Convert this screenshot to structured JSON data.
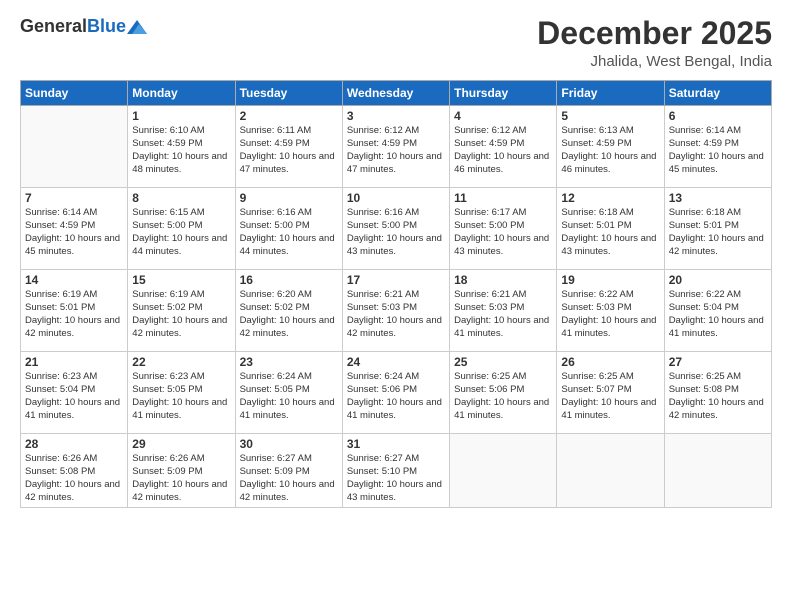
{
  "logo": {
    "general": "General",
    "blue": "Blue"
  },
  "header": {
    "month": "December 2025",
    "location": "Jhalida, West Bengal, India"
  },
  "weekdays": [
    "Sunday",
    "Monday",
    "Tuesday",
    "Wednesday",
    "Thursday",
    "Friday",
    "Saturday"
  ],
  "weeks": [
    [
      {
        "day": "",
        "sunrise": "",
        "sunset": "",
        "daylight": ""
      },
      {
        "day": "1",
        "sunrise": "Sunrise: 6:10 AM",
        "sunset": "Sunset: 4:59 PM",
        "daylight": "Daylight: 10 hours and 48 minutes."
      },
      {
        "day": "2",
        "sunrise": "Sunrise: 6:11 AM",
        "sunset": "Sunset: 4:59 PM",
        "daylight": "Daylight: 10 hours and 47 minutes."
      },
      {
        "day": "3",
        "sunrise": "Sunrise: 6:12 AM",
        "sunset": "Sunset: 4:59 PM",
        "daylight": "Daylight: 10 hours and 47 minutes."
      },
      {
        "day": "4",
        "sunrise": "Sunrise: 6:12 AM",
        "sunset": "Sunset: 4:59 PM",
        "daylight": "Daylight: 10 hours and 46 minutes."
      },
      {
        "day": "5",
        "sunrise": "Sunrise: 6:13 AM",
        "sunset": "Sunset: 4:59 PM",
        "daylight": "Daylight: 10 hours and 46 minutes."
      },
      {
        "day": "6",
        "sunrise": "Sunrise: 6:14 AM",
        "sunset": "Sunset: 4:59 PM",
        "daylight": "Daylight: 10 hours and 45 minutes."
      }
    ],
    [
      {
        "day": "7",
        "sunrise": "Sunrise: 6:14 AM",
        "sunset": "Sunset: 4:59 PM",
        "daylight": "Daylight: 10 hours and 45 minutes."
      },
      {
        "day": "8",
        "sunrise": "Sunrise: 6:15 AM",
        "sunset": "Sunset: 5:00 PM",
        "daylight": "Daylight: 10 hours and 44 minutes."
      },
      {
        "day": "9",
        "sunrise": "Sunrise: 6:16 AM",
        "sunset": "Sunset: 5:00 PM",
        "daylight": "Daylight: 10 hours and 44 minutes."
      },
      {
        "day": "10",
        "sunrise": "Sunrise: 6:16 AM",
        "sunset": "Sunset: 5:00 PM",
        "daylight": "Daylight: 10 hours and 43 minutes."
      },
      {
        "day": "11",
        "sunrise": "Sunrise: 6:17 AM",
        "sunset": "Sunset: 5:00 PM",
        "daylight": "Daylight: 10 hours and 43 minutes."
      },
      {
        "day": "12",
        "sunrise": "Sunrise: 6:18 AM",
        "sunset": "Sunset: 5:01 PM",
        "daylight": "Daylight: 10 hours and 43 minutes."
      },
      {
        "day": "13",
        "sunrise": "Sunrise: 6:18 AM",
        "sunset": "Sunset: 5:01 PM",
        "daylight": "Daylight: 10 hours and 42 minutes."
      }
    ],
    [
      {
        "day": "14",
        "sunrise": "Sunrise: 6:19 AM",
        "sunset": "Sunset: 5:01 PM",
        "daylight": "Daylight: 10 hours and 42 minutes."
      },
      {
        "day": "15",
        "sunrise": "Sunrise: 6:19 AM",
        "sunset": "Sunset: 5:02 PM",
        "daylight": "Daylight: 10 hours and 42 minutes."
      },
      {
        "day": "16",
        "sunrise": "Sunrise: 6:20 AM",
        "sunset": "Sunset: 5:02 PM",
        "daylight": "Daylight: 10 hours and 42 minutes."
      },
      {
        "day": "17",
        "sunrise": "Sunrise: 6:21 AM",
        "sunset": "Sunset: 5:03 PM",
        "daylight": "Daylight: 10 hours and 42 minutes."
      },
      {
        "day": "18",
        "sunrise": "Sunrise: 6:21 AM",
        "sunset": "Sunset: 5:03 PM",
        "daylight": "Daylight: 10 hours and 41 minutes."
      },
      {
        "day": "19",
        "sunrise": "Sunrise: 6:22 AM",
        "sunset": "Sunset: 5:03 PM",
        "daylight": "Daylight: 10 hours and 41 minutes."
      },
      {
        "day": "20",
        "sunrise": "Sunrise: 6:22 AM",
        "sunset": "Sunset: 5:04 PM",
        "daylight": "Daylight: 10 hours and 41 minutes."
      }
    ],
    [
      {
        "day": "21",
        "sunrise": "Sunrise: 6:23 AM",
        "sunset": "Sunset: 5:04 PM",
        "daylight": "Daylight: 10 hours and 41 minutes."
      },
      {
        "day": "22",
        "sunrise": "Sunrise: 6:23 AM",
        "sunset": "Sunset: 5:05 PM",
        "daylight": "Daylight: 10 hours and 41 minutes."
      },
      {
        "day": "23",
        "sunrise": "Sunrise: 6:24 AM",
        "sunset": "Sunset: 5:05 PM",
        "daylight": "Daylight: 10 hours and 41 minutes."
      },
      {
        "day": "24",
        "sunrise": "Sunrise: 6:24 AM",
        "sunset": "Sunset: 5:06 PM",
        "daylight": "Daylight: 10 hours and 41 minutes."
      },
      {
        "day": "25",
        "sunrise": "Sunrise: 6:25 AM",
        "sunset": "Sunset: 5:06 PM",
        "daylight": "Daylight: 10 hours and 41 minutes."
      },
      {
        "day": "26",
        "sunrise": "Sunrise: 6:25 AM",
        "sunset": "Sunset: 5:07 PM",
        "daylight": "Daylight: 10 hours and 41 minutes."
      },
      {
        "day": "27",
        "sunrise": "Sunrise: 6:25 AM",
        "sunset": "Sunset: 5:08 PM",
        "daylight": "Daylight: 10 hours and 42 minutes."
      }
    ],
    [
      {
        "day": "28",
        "sunrise": "Sunrise: 6:26 AM",
        "sunset": "Sunset: 5:08 PM",
        "daylight": "Daylight: 10 hours and 42 minutes."
      },
      {
        "day": "29",
        "sunrise": "Sunrise: 6:26 AM",
        "sunset": "Sunset: 5:09 PM",
        "daylight": "Daylight: 10 hours and 42 minutes."
      },
      {
        "day": "30",
        "sunrise": "Sunrise: 6:27 AM",
        "sunset": "Sunset: 5:09 PM",
        "daylight": "Daylight: 10 hours and 42 minutes."
      },
      {
        "day": "31",
        "sunrise": "Sunrise: 6:27 AM",
        "sunset": "Sunset: 5:10 PM",
        "daylight": "Daylight: 10 hours and 43 minutes."
      },
      {
        "day": "",
        "sunrise": "",
        "sunset": "",
        "daylight": ""
      },
      {
        "day": "",
        "sunrise": "",
        "sunset": "",
        "daylight": ""
      },
      {
        "day": "",
        "sunrise": "",
        "sunset": "",
        "daylight": ""
      }
    ]
  ]
}
